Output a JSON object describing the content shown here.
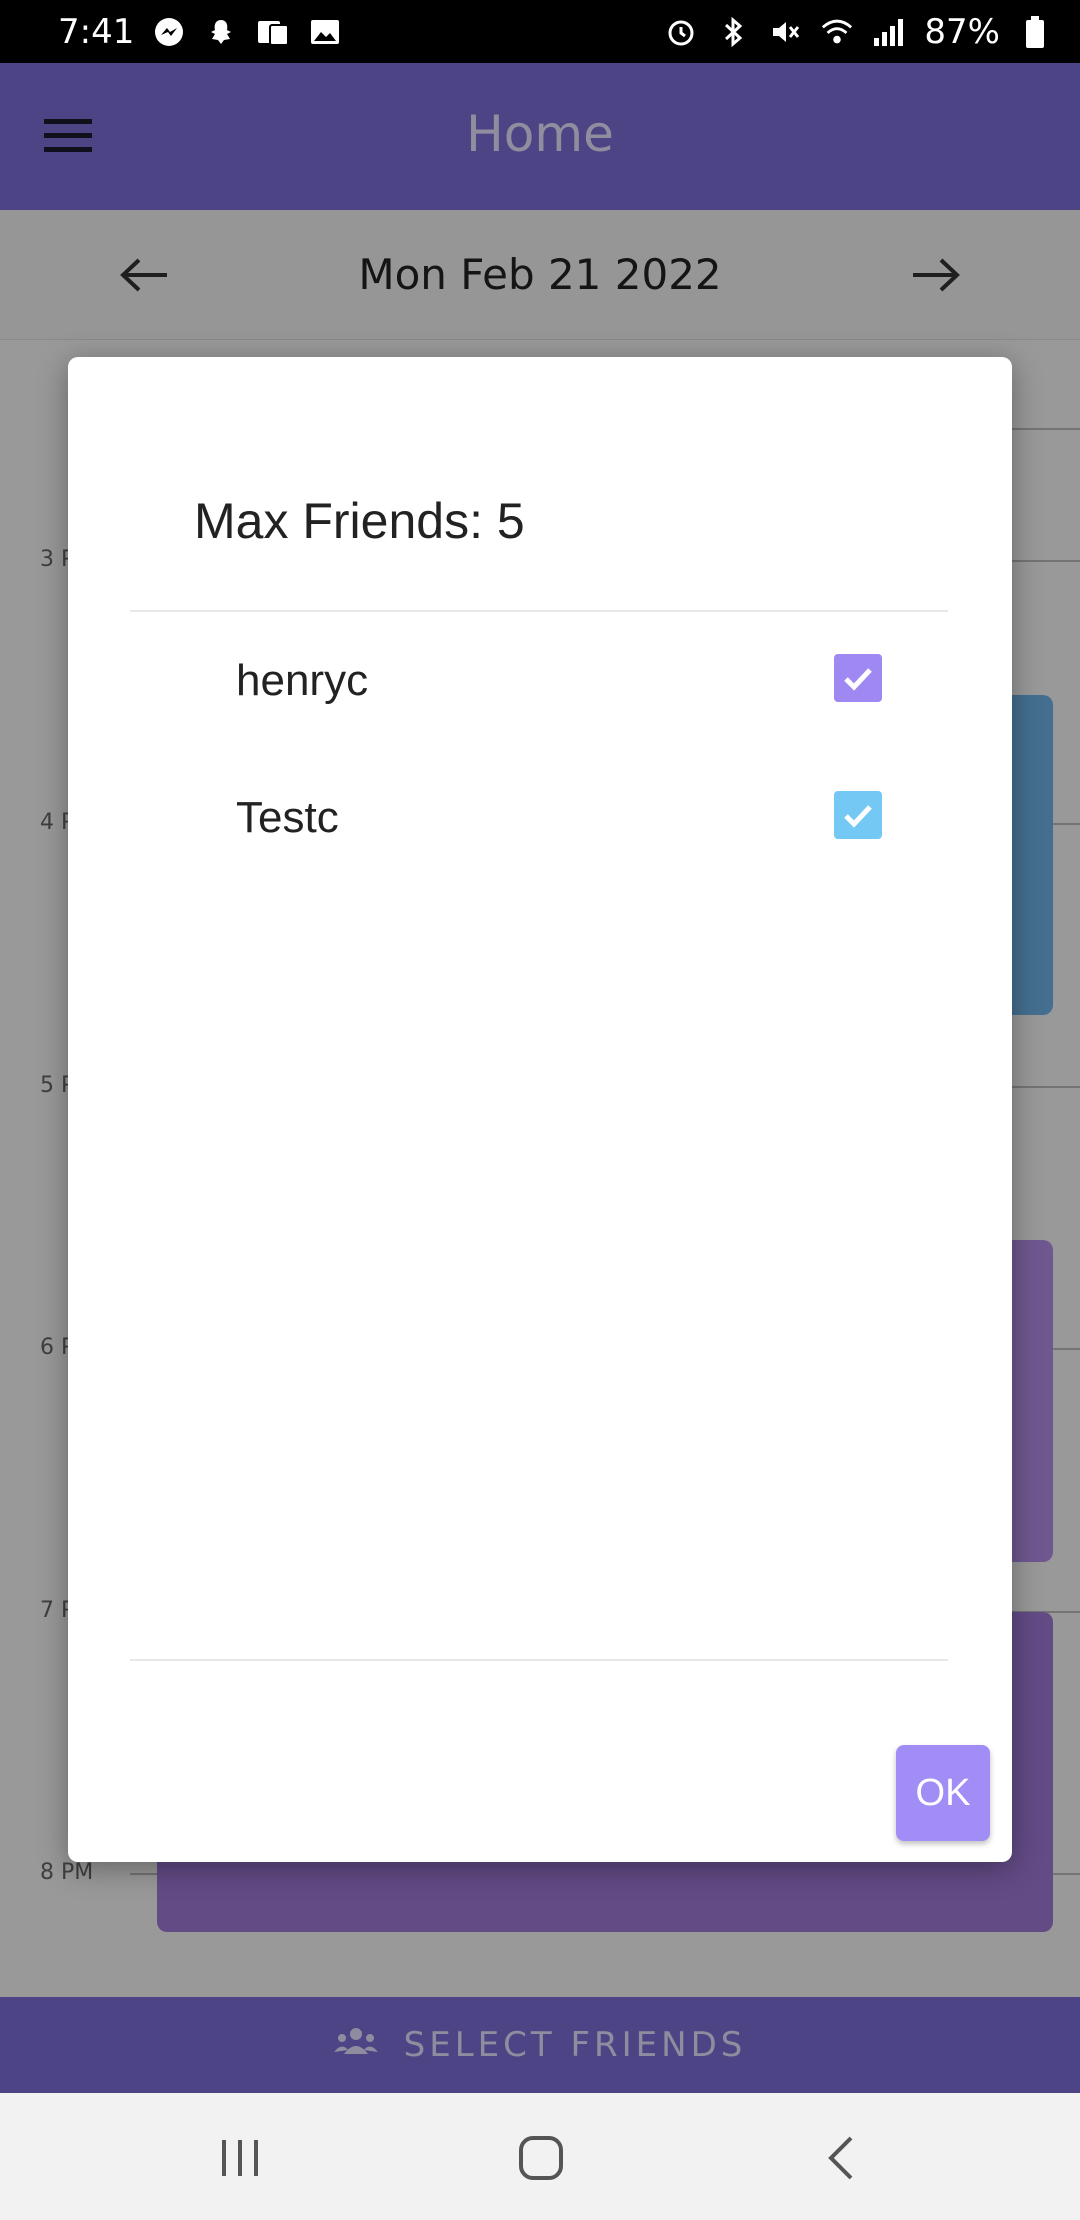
{
  "status_bar": {
    "time": "7:41",
    "battery": "87%"
  },
  "app_bar": {
    "title": "Home"
  },
  "date_nav": {
    "date": "Mon Feb 21 2022"
  },
  "calendar": {
    "hours": [
      "3 P",
      "4 P",
      "5 P",
      "6 P",
      "7 P",
      "8 PM"
    ],
    "event_colors": {
      "blue": "#4a8ec2",
      "purple": "#9b6fd6"
    }
  },
  "dialog": {
    "title": "Max Friends: 5",
    "friends": [
      {
        "name": "henryc",
        "checked": true,
        "color": "#9f88f2"
      },
      {
        "name": "Testc",
        "checked": true,
        "color": "#74c8f4"
      }
    ],
    "ok_label": "OK"
  },
  "select_bar": {
    "label": "SELECT FRIENDS"
  },
  "colors": {
    "primary": "#7b6fd6",
    "accent": "#a28cf6"
  }
}
